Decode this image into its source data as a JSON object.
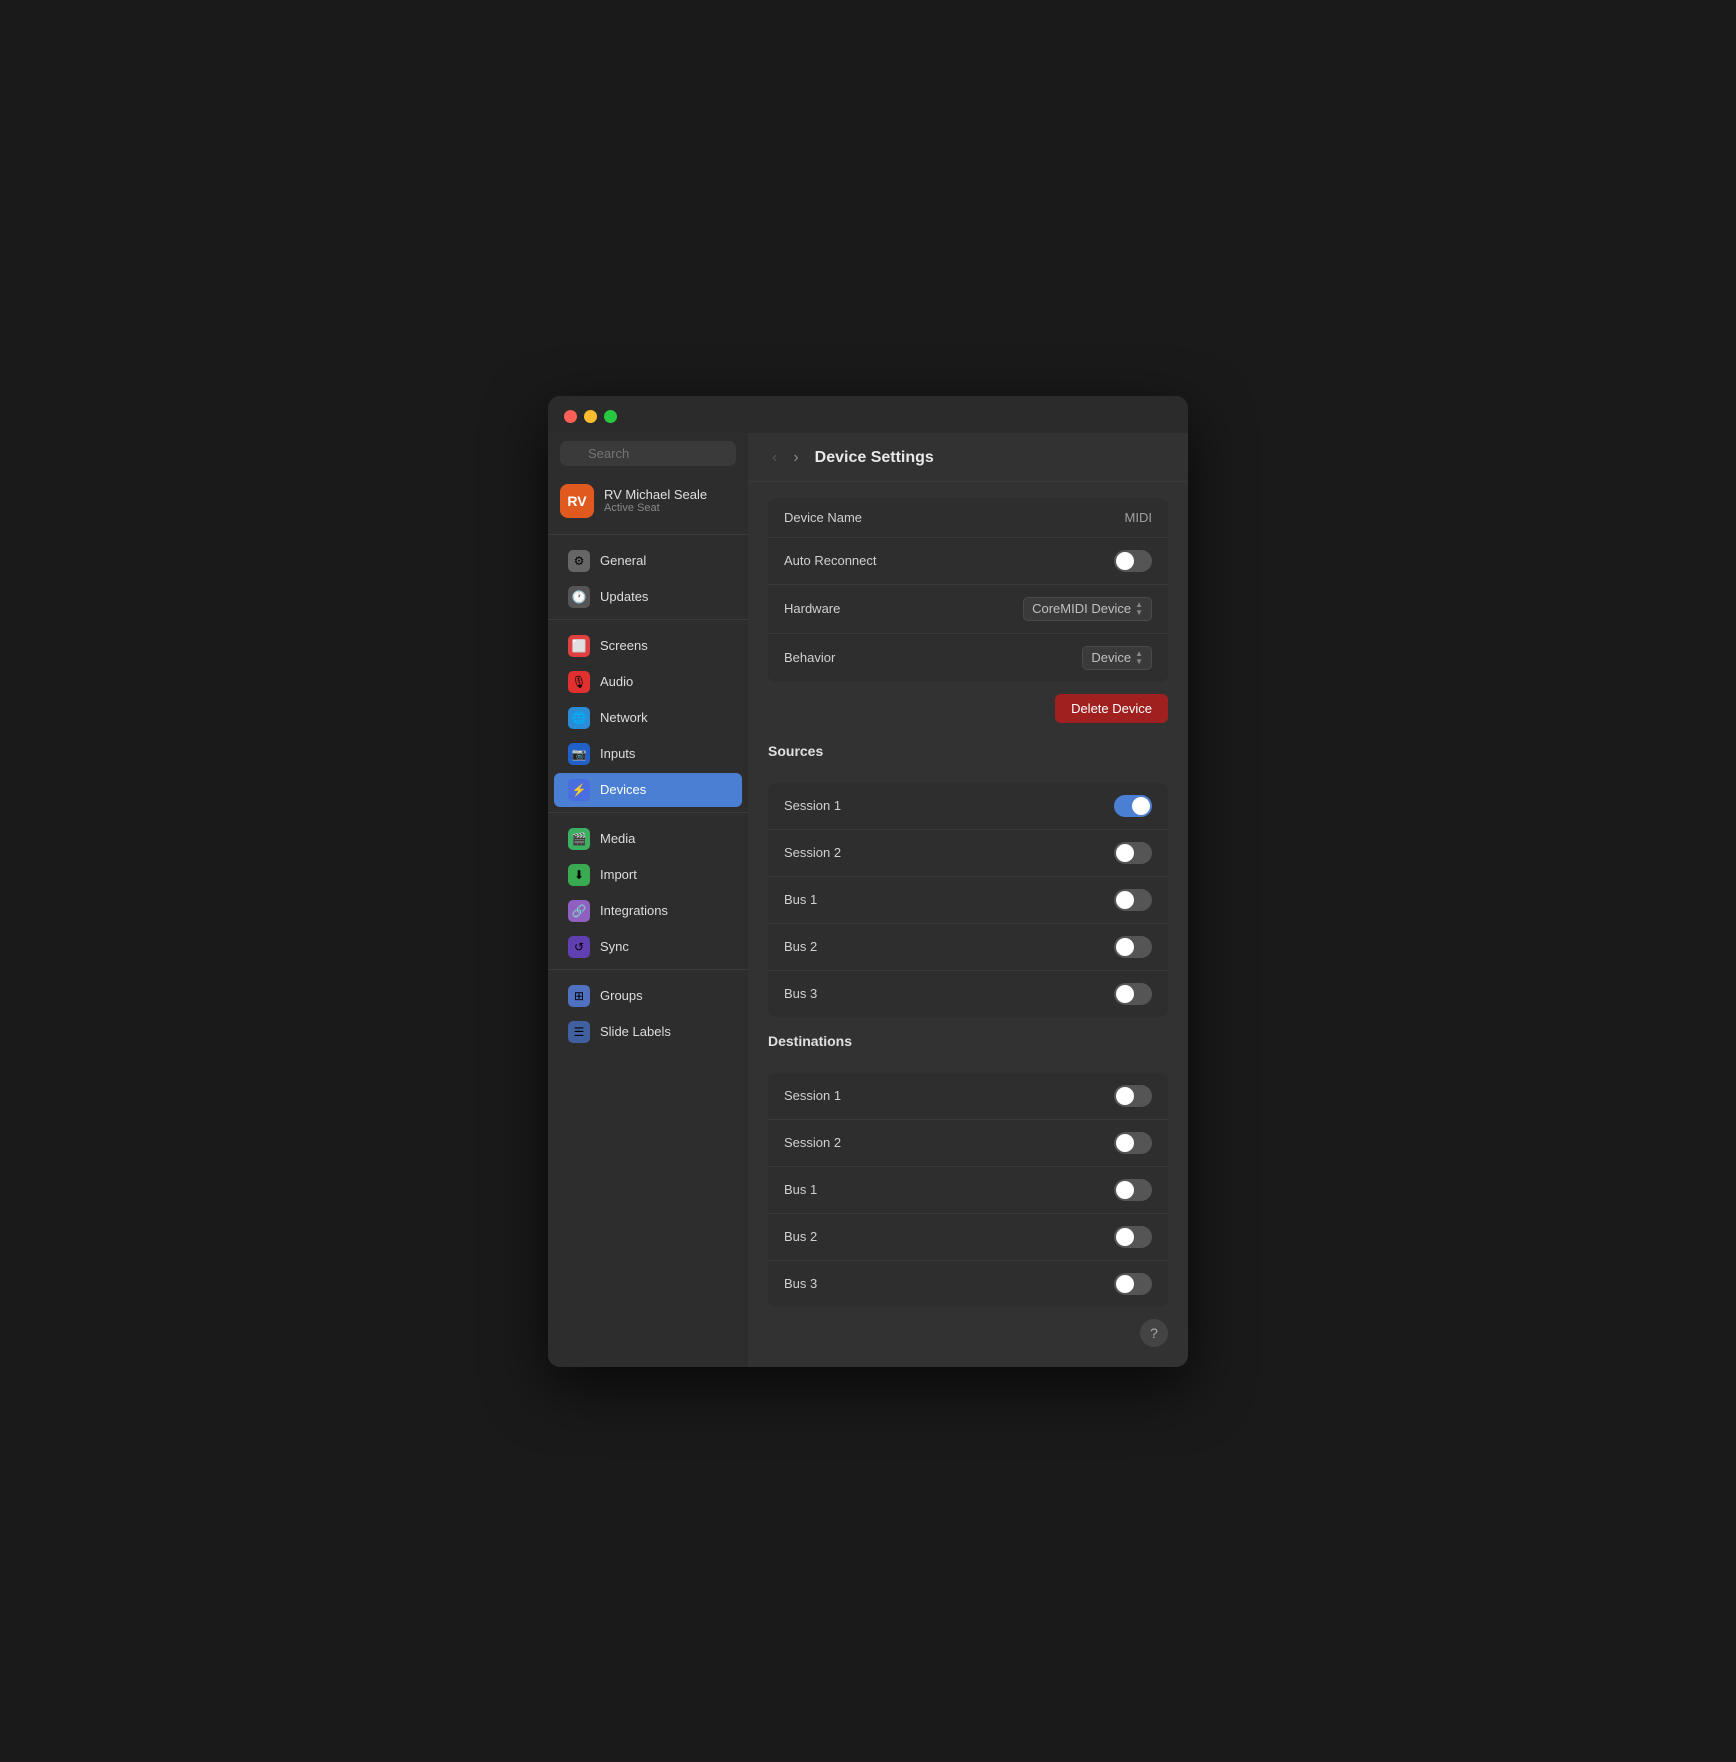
{
  "window": {
    "title": "Device Settings"
  },
  "traffic_lights": {
    "red": "close",
    "yellow": "minimize",
    "green": "maximize"
  },
  "sidebar": {
    "search_placeholder": "Search",
    "user": {
      "initials": "RV",
      "name": "RV Michael Seale",
      "status": "Active Seat"
    },
    "items": [
      {
        "id": "general",
        "label": "General",
        "icon": "⚙️",
        "active": false
      },
      {
        "id": "updates",
        "label": "Updates",
        "icon": "🕐",
        "active": false
      },
      {
        "id": "screens",
        "label": "Screens",
        "icon": "🖥️",
        "active": false
      },
      {
        "id": "audio",
        "label": "Audio",
        "icon": "🎵",
        "active": false
      },
      {
        "id": "network",
        "label": "Network",
        "icon": "🌐",
        "active": false
      },
      {
        "id": "inputs",
        "label": "Inputs",
        "icon": "📹",
        "active": false
      },
      {
        "id": "devices",
        "label": "Devices",
        "icon": "⚡",
        "active": true
      },
      {
        "id": "media",
        "label": "Media",
        "icon": "🎬",
        "active": false
      },
      {
        "id": "import",
        "label": "Import",
        "icon": "⬇️",
        "active": false
      },
      {
        "id": "integrations",
        "label": "Integrations",
        "icon": "🔗",
        "active": false
      },
      {
        "id": "sync",
        "label": "Sync",
        "icon": "🔄",
        "active": false
      },
      {
        "id": "groups",
        "label": "Groups",
        "icon": "⊞",
        "active": false
      },
      {
        "id": "slide-labels",
        "label": "Slide Labels",
        "icon": "☰",
        "active": false
      }
    ]
  },
  "content": {
    "title": "Device Settings",
    "device_name_label": "Device Name",
    "device_name_value": "MIDI",
    "auto_reconnect_label": "Auto Reconnect",
    "hardware_label": "Hardware",
    "hardware_value": "CoreMIDI Device",
    "behavior_label": "Behavior",
    "behavior_value": "Device",
    "delete_button_label": "Delete Device",
    "sources_section_label": "Sources",
    "destinations_section_label": "Destinations",
    "sources": [
      {
        "label": "Session 1",
        "on": true
      },
      {
        "label": "Session 2",
        "on": false
      },
      {
        "label": "Bus 1",
        "on": false
      },
      {
        "label": "Bus 2",
        "on": false
      },
      {
        "label": "Bus 3",
        "on": false
      }
    ],
    "destinations": [
      {
        "label": "Session 1",
        "on": false
      },
      {
        "label": "Session 2",
        "on": false
      },
      {
        "label": "Bus 1",
        "on": false
      },
      {
        "label": "Bus 2",
        "on": false
      },
      {
        "label": "Bus 3",
        "on": false
      }
    ],
    "help_button_label": "?"
  }
}
